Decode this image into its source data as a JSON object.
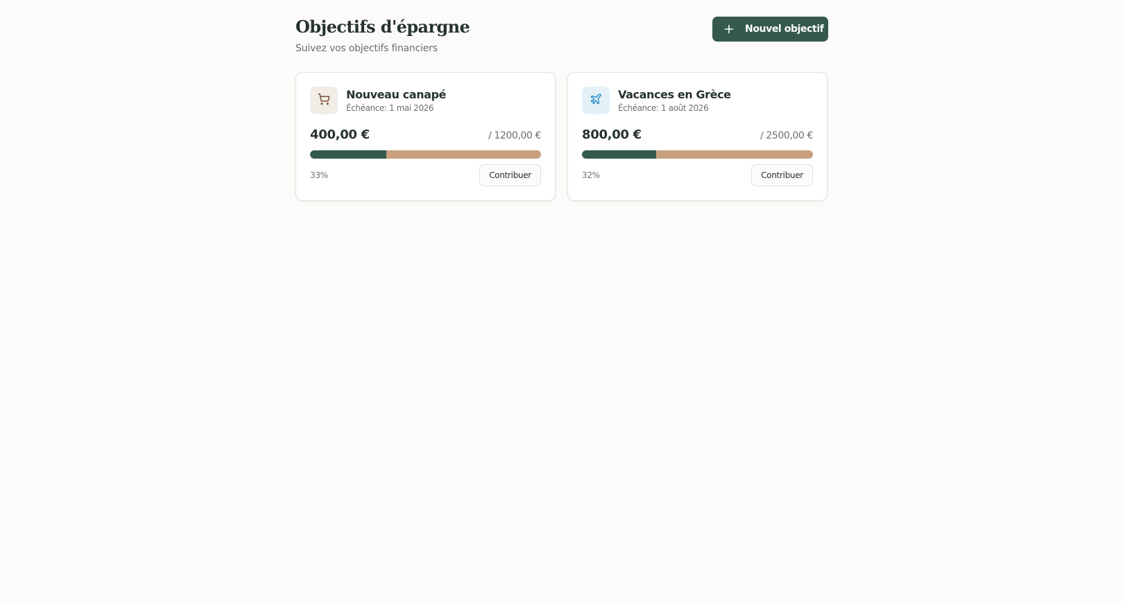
{
  "header": {
    "title": "Objectifs d'épargne",
    "subtitle": "Suivez vos objectifs financiers",
    "new_goal_label": "Nouvel objectif"
  },
  "colors": {
    "accent": "#355a4d",
    "progress_remaining": "#c9a07e",
    "background": "#fcfbf9"
  },
  "goals": [
    {
      "icon": "shopping-cart-icon",
      "name": "Nouveau canapé",
      "due": "Échéance: 1 mai 2026",
      "saved": "400,00 €",
      "target": "/ 1200,00 €",
      "percent_label": "33%",
      "progress": 0.33,
      "button_label": "Contribuer"
    },
    {
      "icon": "plane-icon",
      "name": "Vacances en Grèce",
      "due": "Échéance: 1 août 2026",
      "saved": "800,00 €",
      "target": "/ 2500,00 €",
      "percent_label": "32%",
      "progress": 0.32,
      "button_label": "Contribuer"
    }
  ]
}
